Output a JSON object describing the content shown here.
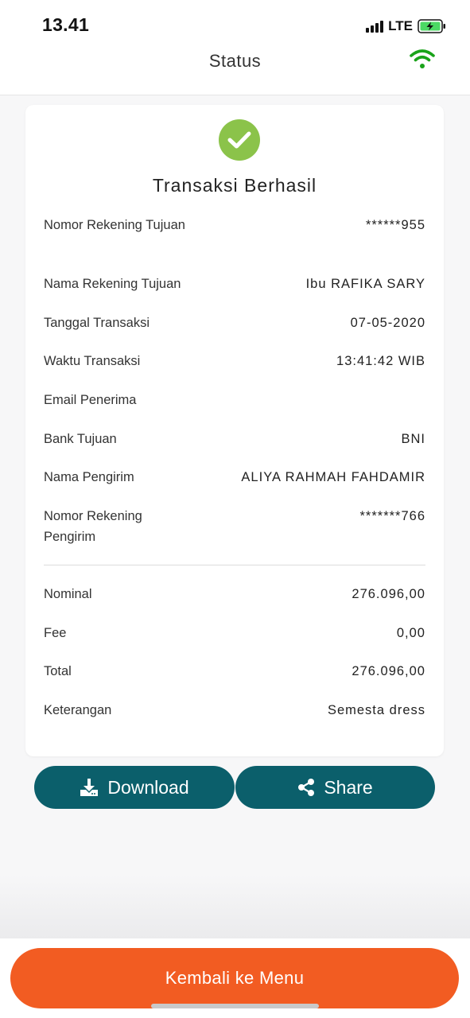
{
  "status_bar": {
    "time": "13.41",
    "network": "LTE"
  },
  "header": {
    "title": "Status"
  },
  "card": {
    "title": "Transaksi Berhasil",
    "rows": [
      {
        "label": "Nomor Rekening Tujuan",
        "value": "******955"
      },
      {
        "label": "Nama Rekening Tujuan",
        "value": "Ibu RAFIKA SARY"
      },
      {
        "label": "Tanggal Transaksi",
        "value": "07-05-2020"
      },
      {
        "label": "Waktu Transaksi",
        "value": "13:41:42 WIB"
      },
      {
        "label": "Email Penerima",
        "value": ""
      },
      {
        "label": "Bank Tujuan",
        "value": "BNI"
      },
      {
        "label": "Nama Pengirim",
        "value": "ALIYA RAHMAH FAHDAMIR"
      },
      {
        "label": "Nomor Rekening Pengirim",
        "value": "*******766"
      }
    ],
    "summary": [
      {
        "label": "Nominal",
        "value": "276.096,00"
      },
      {
        "label": "Fee",
        "value": "0,00"
      },
      {
        "label": "Total",
        "value": "276.096,00"
      },
      {
        "label": "Keterangan",
        "value": "Semesta dress"
      }
    ]
  },
  "actions": {
    "download_label": "Download",
    "share_label": "Share"
  },
  "footer": {
    "menu_label": "Kembali ke Menu"
  },
  "colors": {
    "accent_teal": "#0b5f6b",
    "accent_orange": "#f25c22",
    "success_green": "#8bc34a",
    "wifi_green": "#1aa31a"
  },
  "icons": {
    "status_bar": [
      "signal-icon",
      "battery-charging-icon"
    ],
    "header": "wifi-icon",
    "card": "check-circle-icon",
    "download": "download-icon",
    "share": "share-icon"
  }
}
